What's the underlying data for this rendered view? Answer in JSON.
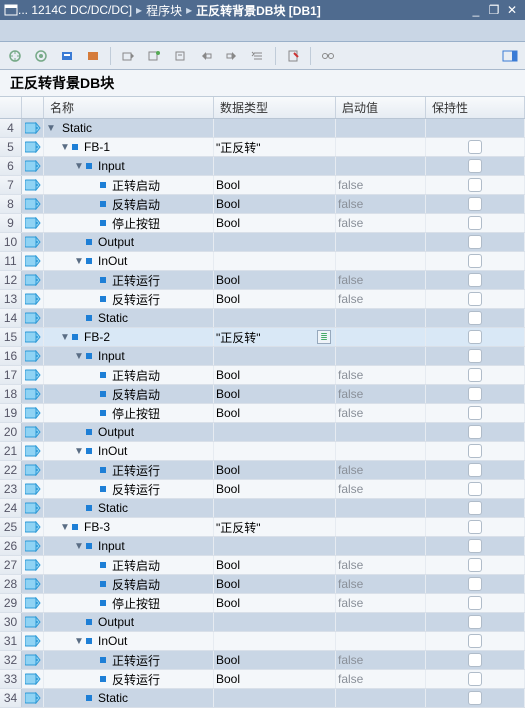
{
  "titlebar": {
    "crumb1": "... 1214C DC/DC/DC]",
    "crumb2": "程序块",
    "crumb3": "正反转背景DB块 [DB1]"
  },
  "block_title": "正反转背景DB块",
  "columns": {
    "name": "名称",
    "type": "数据类型",
    "init": "启动值",
    "retain": "保持性"
  },
  "rows": [
    {
      "n": "4",
      "ind": 0,
      "icon": "tag",
      "arrow": "down",
      "sq": 0,
      "text": "Static",
      "type": "",
      "init": "",
      "ret": 0,
      "sel": 0
    },
    {
      "n": "5",
      "ind": 1,
      "icon": "tag",
      "arrow": "down",
      "sq": 1,
      "text": "FB-1",
      "type": "\"正反转\"",
      "init": "",
      "ret": 1,
      "sel": 0
    },
    {
      "n": "6",
      "ind": 2,
      "icon": "tag",
      "arrow": "down",
      "sq": 1,
      "text": "Input",
      "type": "",
      "init": "",
      "ret": 1,
      "sel": 0
    },
    {
      "n": "7",
      "ind": 3,
      "icon": "tag",
      "arrow": "",
      "sq": 1,
      "text": "正转启动",
      "type": "Bool",
      "init": "false",
      "ret": 1,
      "sel": 0
    },
    {
      "n": "8",
      "ind": 3,
      "icon": "tag",
      "arrow": "",
      "sq": 1,
      "text": "反转启动",
      "type": "Bool",
      "init": "false",
      "ret": 1,
      "sel": 0
    },
    {
      "n": "9",
      "ind": 3,
      "icon": "tag",
      "arrow": "",
      "sq": 1,
      "text": "停止按钮",
      "type": "Bool",
      "init": "false",
      "ret": 1,
      "sel": 0
    },
    {
      "n": "10",
      "ind": 2,
      "icon": "tag",
      "arrow": "",
      "sq": 1,
      "text": "Output",
      "type": "",
      "init": "",
      "ret": 1,
      "sel": 0
    },
    {
      "n": "11",
      "ind": 2,
      "icon": "tag",
      "arrow": "down",
      "sq": 1,
      "text": "InOut",
      "type": "",
      "init": "",
      "ret": 1,
      "sel": 0
    },
    {
      "n": "12",
      "ind": 3,
      "icon": "tag",
      "arrow": "",
      "sq": 1,
      "text": "正转运行",
      "type": "Bool",
      "init": "false",
      "ret": 1,
      "sel": 0
    },
    {
      "n": "13",
      "ind": 3,
      "icon": "tag",
      "arrow": "",
      "sq": 1,
      "text": "反转运行",
      "type": "Bool",
      "init": "false",
      "ret": 1,
      "sel": 0
    },
    {
      "n": "14",
      "ind": 2,
      "icon": "tag",
      "arrow": "",
      "sq": 1,
      "text": "Static",
      "type": "",
      "init": "",
      "ret": 1,
      "sel": 0
    },
    {
      "n": "15",
      "ind": 1,
      "icon": "tag",
      "arrow": "down",
      "sq": 1,
      "text": "FB-2",
      "type": "\"正反转\"",
      "init": "",
      "ret": 1,
      "sel": 1,
      "typebtn": 1
    },
    {
      "n": "16",
      "ind": 2,
      "icon": "tag",
      "arrow": "down",
      "sq": 1,
      "text": "Input",
      "type": "",
      "init": "",
      "ret": 1,
      "sel": 0
    },
    {
      "n": "17",
      "ind": 3,
      "icon": "tag",
      "arrow": "",
      "sq": 1,
      "text": "正转启动",
      "type": "Bool",
      "init": "false",
      "ret": 1,
      "sel": 0
    },
    {
      "n": "18",
      "ind": 3,
      "icon": "tag",
      "arrow": "",
      "sq": 1,
      "text": "反转启动",
      "type": "Bool",
      "init": "false",
      "ret": 1,
      "sel": 0
    },
    {
      "n": "19",
      "ind": 3,
      "icon": "tag",
      "arrow": "",
      "sq": 1,
      "text": "停止按钮",
      "type": "Bool",
      "init": "false",
      "ret": 1,
      "sel": 0
    },
    {
      "n": "20",
      "ind": 2,
      "icon": "tag",
      "arrow": "",
      "sq": 1,
      "text": "Output",
      "type": "",
      "init": "",
      "ret": 1,
      "sel": 0
    },
    {
      "n": "21",
      "ind": 2,
      "icon": "tag",
      "arrow": "down",
      "sq": 1,
      "text": "InOut",
      "type": "",
      "init": "",
      "ret": 1,
      "sel": 0
    },
    {
      "n": "22",
      "ind": 3,
      "icon": "tag",
      "arrow": "",
      "sq": 1,
      "text": "正转运行",
      "type": "Bool",
      "init": "false",
      "ret": 1,
      "sel": 0
    },
    {
      "n": "23",
      "ind": 3,
      "icon": "tag",
      "arrow": "",
      "sq": 1,
      "text": "反转运行",
      "type": "Bool",
      "init": "false",
      "ret": 1,
      "sel": 0
    },
    {
      "n": "24",
      "ind": 2,
      "icon": "tag",
      "arrow": "",
      "sq": 1,
      "text": "Static",
      "type": "",
      "init": "",
      "ret": 1,
      "sel": 0
    },
    {
      "n": "25",
      "ind": 1,
      "icon": "tag",
      "arrow": "down",
      "sq": 1,
      "text": "FB-3",
      "type": "\"正反转\"",
      "init": "",
      "ret": 1,
      "sel": 0
    },
    {
      "n": "26",
      "ind": 2,
      "icon": "tag",
      "arrow": "down",
      "sq": 1,
      "text": "Input",
      "type": "",
      "init": "",
      "ret": 1,
      "sel": 0
    },
    {
      "n": "27",
      "ind": 3,
      "icon": "tag",
      "arrow": "",
      "sq": 1,
      "text": "正转启动",
      "type": "Bool",
      "init": "false",
      "ret": 1,
      "sel": 0
    },
    {
      "n": "28",
      "ind": 3,
      "icon": "tag",
      "arrow": "",
      "sq": 1,
      "text": "反转启动",
      "type": "Bool",
      "init": "false",
      "ret": 1,
      "sel": 0
    },
    {
      "n": "29",
      "ind": 3,
      "icon": "tag",
      "arrow": "",
      "sq": 1,
      "text": "停止按钮",
      "type": "Bool",
      "init": "false",
      "ret": 1,
      "sel": 0
    },
    {
      "n": "30",
      "ind": 2,
      "icon": "tag",
      "arrow": "",
      "sq": 1,
      "text": "Output",
      "type": "",
      "init": "",
      "ret": 1,
      "sel": 0
    },
    {
      "n": "31",
      "ind": 2,
      "icon": "tag",
      "arrow": "down",
      "sq": 1,
      "text": "InOut",
      "type": "",
      "init": "",
      "ret": 1,
      "sel": 0
    },
    {
      "n": "32",
      "ind": 3,
      "icon": "tag",
      "arrow": "",
      "sq": 1,
      "text": "正转运行",
      "type": "Bool",
      "init": "false",
      "ret": 1,
      "sel": 0
    },
    {
      "n": "33",
      "ind": 3,
      "icon": "tag",
      "arrow": "",
      "sq": 1,
      "text": "反转运行",
      "type": "Bool",
      "init": "false",
      "ret": 1,
      "sel": 0
    },
    {
      "n": "34",
      "ind": 2,
      "icon": "tag",
      "arrow": "",
      "sq": 1,
      "text": "Static",
      "type": "",
      "init": "",
      "ret": 1,
      "sel": 0
    }
  ]
}
